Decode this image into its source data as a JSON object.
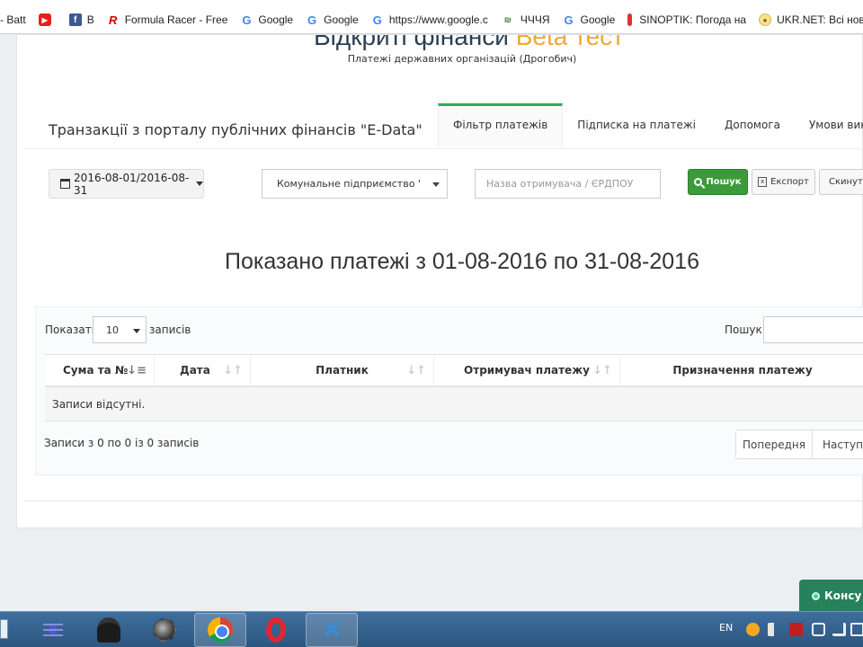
{
  "browser": {
    "bookmarks": [
      {
        "label": "- Batt",
        "icon": "none"
      },
      {
        "label": "",
        "icon": "youtube-icon"
      },
      {
        "label": "B",
        "icon": "facebook-icon"
      },
      {
        "label": "Formula Racer - Free",
        "icon": "formula-racer-icon"
      },
      {
        "label": "Google",
        "icon": "google-icon"
      },
      {
        "label": "Google",
        "icon": "google-icon"
      },
      {
        "label": "https://www.google.c",
        "icon": "google-icon"
      },
      {
        "label": "ЧЧЧЯ",
        "icon": "chchchya-icon"
      },
      {
        "label": "Google",
        "icon": "google-icon"
      },
      {
        "label": "SINOPTIK: Погода на",
        "icon": "sinoptik-icon"
      },
      {
        "label": "UKR.NET: Всі нов",
        "icon": "ukrnet-icon"
      }
    ]
  },
  "site": {
    "header_partial": "Відкриті фінанси",
    "header_accent": "Beta тест",
    "subtitle": "Платежі державних організацій (Дрогобич)"
  },
  "portal": {
    "title": "Транзакції з порталу публічних фінансів \"E-Data\"",
    "tabs": [
      "Фільтр платежів",
      "Підписка на платежі",
      "Допомога",
      "Умови використа"
    ]
  },
  "filter": {
    "date_range": "2016-08-01/2016-08-31",
    "organization": "Комунальне підприємство \"Ж",
    "recipient_placeholder": "Назва отримувача / ЄРДПОУ",
    "search_label": "Пошук",
    "export_label": "Експорт",
    "reset_label": "Скинути"
  },
  "main": {
    "heading": "Показано платежі з 01-08-2016 по 31-08-2016"
  },
  "table": {
    "show_label": "Показати",
    "page_length": "10",
    "records_label": "записів",
    "search_label": "Пошук:",
    "columns": [
      "Сума та №",
      "Дата",
      "Платник",
      "Отримувач платежу",
      "Призначення платежу"
    ],
    "empty_text": "Записи відсутні.",
    "info_text": "Записи з 0 по 0 із 0 записів",
    "prev_label": "Попередня",
    "next_label": "Наступна"
  },
  "widget": {
    "consult_label": "Консу"
  },
  "taskbar": {
    "language": "EN",
    "apps": [
      "blank-window",
      "spider-icon",
      "spy-icon",
      "mine-icon",
      "chrome-icon",
      "opera-icon",
      "x-app-icon"
    ]
  },
  "colors": {
    "accent_green": "#27ae60",
    "search_button": "#3c9a3a",
    "header_accent": "#f0a830"
  }
}
